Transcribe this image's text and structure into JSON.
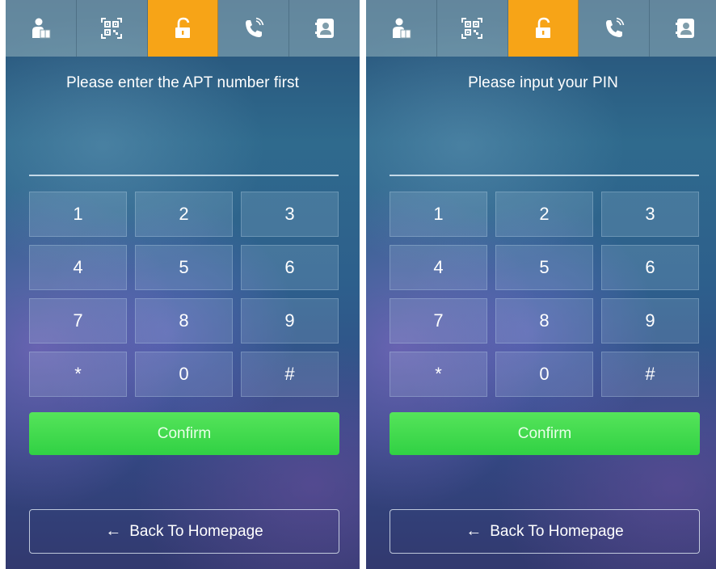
{
  "tabs": [
    {
      "icon": "delivery-person-icon"
    },
    {
      "icon": "qr-code-icon"
    },
    {
      "icon": "unlock-icon",
      "active": true
    },
    {
      "icon": "phone-call-icon"
    },
    {
      "icon": "contacts-icon"
    }
  ],
  "colors": {
    "active_tab": "#f7a417",
    "confirm": "#3ed94e",
    "text": "#ffffff"
  },
  "screens": [
    {
      "prompt": "Please enter the APT number first",
      "keys": [
        "1",
        "2",
        "3",
        "4",
        "5",
        "6",
        "7",
        "8",
        "9",
        "*",
        "0",
        "#"
      ],
      "confirm_label": "Confirm",
      "back_arrow": "←",
      "back_label": "Back To Homepage"
    },
    {
      "prompt": "Please input your PIN",
      "keys": [
        "1",
        "2",
        "3",
        "4",
        "5",
        "6",
        "7",
        "8",
        "9",
        "*",
        "0",
        "#"
      ],
      "confirm_label": "Confirm",
      "back_arrow": "←",
      "back_label": "Back To Homepage"
    }
  ]
}
